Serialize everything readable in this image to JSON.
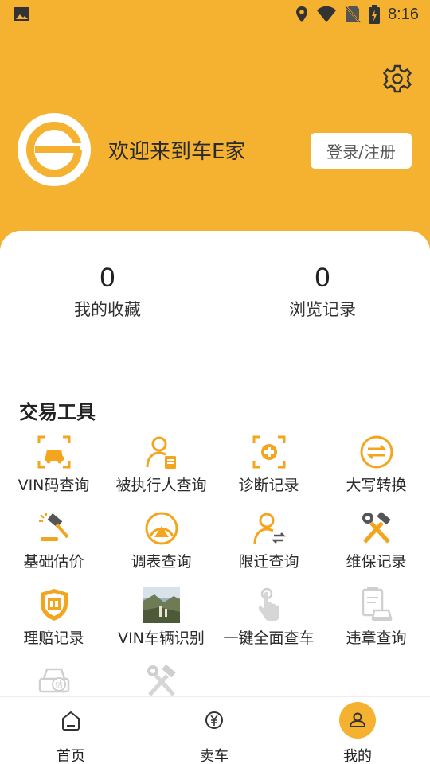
{
  "status_bar": {
    "time": "8:16"
  },
  "header": {
    "welcome_text": "欢迎来到车E家",
    "login_button": "登录/注册"
  },
  "stats": [
    {
      "value": "0",
      "label": "我的收藏"
    },
    {
      "value": "0",
      "label": "浏览记录"
    }
  ],
  "tools_section": {
    "title": "交易工具",
    "items": [
      {
        "label": "VIN码查询",
        "icon": "vin-scan-icon"
      },
      {
        "label": "被执行人查询",
        "icon": "person-document-icon"
      },
      {
        "label": "诊断记录",
        "icon": "diagnosis-icon"
      },
      {
        "label": "大写转换",
        "icon": "convert-arrows-icon"
      },
      {
        "label": "基础估价",
        "icon": "gavel-icon"
      },
      {
        "label": "调表查询",
        "icon": "odometer-icon"
      },
      {
        "label": "限迁查询",
        "icon": "person-transfer-icon"
      },
      {
        "label": "维保记录",
        "icon": "tools-icon"
      },
      {
        "label": "理赔记录",
        "icon": "claim-shield-icon"
      },
      {
        "label": "VIN车辆识别",
        "icon": "photo-thumbnail"
      },
      {
        "label": "一键全面查车",
        "icon": "touch-icon"
      },
      {
        "label": "违章查询",
        "icon": "violation-icon"
      },
      {
        "label": "",
        "icon": "car-valuation-icon"
      },
      {
        "label": "",
        "icon": "tools-icon"
      }
    ]
  },
  "bottom_nav": [
    {
      "label": "首页",
      "icon": "home-icon",
      "active": false
    },
    {
      "label": "卖车",
      "icon": "yen-icon",
      "active": false
    },
    {
      "label": "我的",
      "icon": "user-icon",
      "active": true
    }
  ],
  "colors": {
    "accent": "#f5b230",
    "icon_orange": "#f3a51e",
    "disabled": "#cfcfcf"
  }
}
